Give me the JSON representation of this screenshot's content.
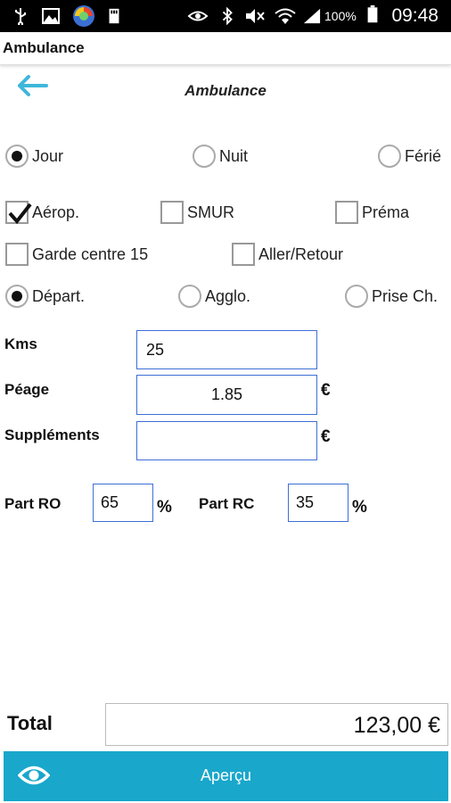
{
  "status_bar": {
    "time": "09:48",
    "battery_percent": "100%",
    "icons": [
      "usb-icon",
      "image-icon",
      "browser-icon",
      "sd-card-icon",
      "eye-icon",
      "bluetooth-icon",
      "mute-icon",
      "wifi-icon",
      "signal-icon",
      "battery-icon"
    ]
  },
  "app_title": "Ambulance",
  "screen_title": "Ambulance",
  "period": {
    "options": [
      "Jour",
      "Nuit",
      "Férié"
    ],
    "selected": "Jour"
  },
  "checkboxes": [
    {
      "label": "Aérop.",
      "checked": true
    },
    {
      "label": "SMUR",
      "checked": false
    },
    {
      "label": "Préma",
      "checked": false
    },
    {
      "label": "Garde centre 15",
      "checked": false
    },
    {
      "label": "Aller/Retour",
      "checked": false
    }
  ],
  "zone": {
    "options": [
      "Départ.",
      "Agglo.",
      "Prise Ch."
    ],
    "selected": "Départ."
  },
  "fields": {
    "kms_label": "Kms",
    "kms_value": "25",
    "peage_label": "Péage",
    "peage_value": "1.85",
    "peage_unit": "€",
    "supplements_label": "Suppléments",
    "supplements_value": "",
    "supplements_unit": "€",
    "part_ro_label": "Part RO",
    "part_ro_value": "65",
    "part_ro_unit": "%",
    "part_rc_label": "Part RC",
    "part_rc_value": "35",
    "part_rc_unit": "%"
  },
  "total": {
    "label": "Total",
    "value": "123,00 €"
  },
  "preview_button": {
    "label": "Aperçu"
  },
  "colors": {
    "accent": "#19a7cb",
    "field_border": "#3d6fd6",
    "back_arrow": "#3fb7da"
  }
}
